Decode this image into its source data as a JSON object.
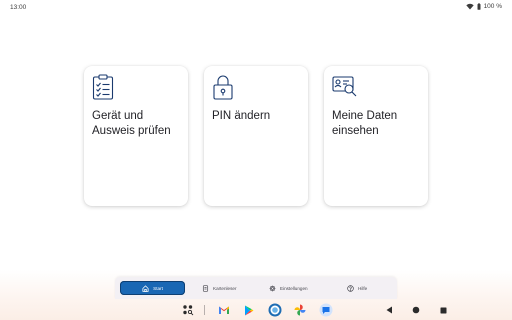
{
  "status_bar": {
    "time": "13:00",
    "battery": "100 %",
    "icons": [
      "wifi-icon",
      "battery-icon"
    ]
  },
  "cards": [
    {
      "title": "Gerät und Ausweis prüfen",
      "icon": "checklist-icon"
    },
    {
      "title": "PIN ändern",
      "icon": "lock-icon"
    },
    {
      "title": "Meine Daten einsehen",
      "icon": "id-card-search-icon"
    }
  ],
  "tabs": [
    {
      "label": "Start",
      "icon": "home-icon",
      "selected": true
    },
    {
      "label": "Kartenleser",
      "icon": "card-reader-icon",
      "selected": false
    },
    {
      "label": "Einstellungen",
      "icon": "gear-icon",
      "selected": false
    },
    {
      "label": "Hilfe",
      "icon": "help-icon",
      "selected": false
    }
  ],
  "dock": {
    "apps": [
      "app-drawer-icon",
      "gmail-icon",
      "play-store-icon",
      "ausweisapp-icon",
      "photos-icon",
      "messages-icon"
    ],
    "nav": [
      "back-icon",
      "home-circle-icon",
      "recents-icon"
    ]
  },
  "colors": {
    "accent": "#1967b4",
    "icon_stroke": "#1a3a6e",
    "card_background": "#ffffff"
  }
}
